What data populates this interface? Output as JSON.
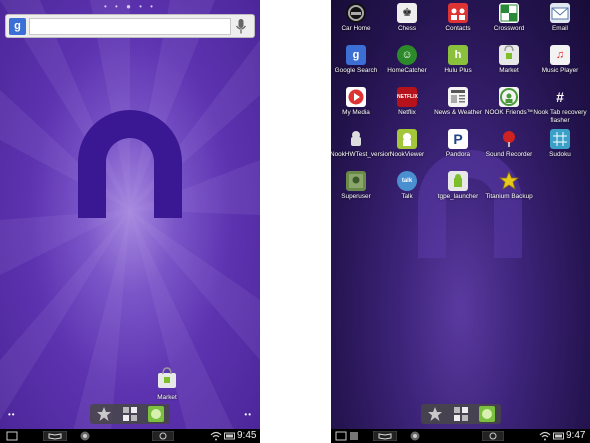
{
  "left": {
    "search_placeholder": "",
    "market_label": "Market",
    "time": "9:45"
  },
  "right": {
    "time": "9:47",
    "apps": [
      {
        "label": "Car Home"
      },
      {
        "label": "Chess"
      },
      {
        "label": "Contacts"
      },
      {
        "label": "Crossword"
      },
      {
        "label": "Email"
      },
      {
        "label": "Google Search"
      },
      {
        "label": "HomeCatcher"
      },
      {
        "label": "Hulu Plus"
      },
      {
        "label": "Market"
      },
      {
        "label": "Music Player"
      },
      {
        "label": "My Media"
      },
      {
        "label": "Netflix"
      },
      {
        "label": "News & Weather"
      },
      {
        "label": "NOOK Friends™"
      },
      {
        "label": "Nook Tab recovery flasher"
      },
      {
        "label": "NookHWTest_version"
      },
      {
        "label": "NookViewer"
      },
      {
        "label": "Pandora"
      },
      {
        "label": "Sound Recorder"
      },
      {
        "label": "Sudoku"
      },
      {
        "label": "Superuser"
      },
      {
        "label": "Talk"
      },
      {
        "label": "tgpe_launcher"
      },
      {
        "label": "Titanium Backup"
      }
    ]
  },
  "icons": {
    "dock": [
      "star-icon",
      "apps-grid-icon",
      "browser-globe-icon"
    ],
    "statusbar": [
      "nook-book-icon",
      "circle-app-icon",
      "wifi-icon",
      "battery-icon"
    ]
  }
}
